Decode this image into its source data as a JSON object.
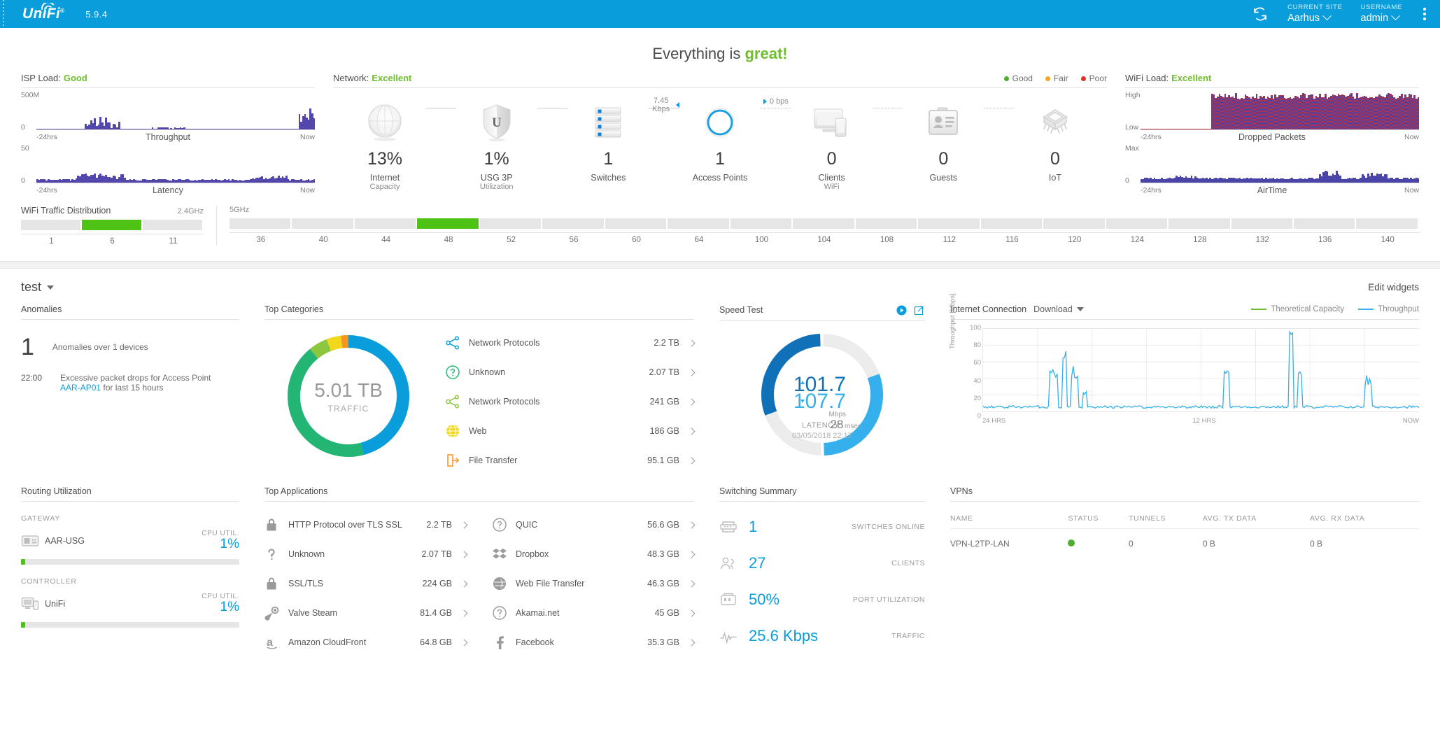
{
  "topbar": {
    "logo": "UniFi",
    "version": "5.9.4",
    "refresh_icon": "refresh-icon",
    "current_site_label": "CURRENT SITE",
    "current_site_value": "Aarhus",
    "username_label": "USERNAME",
    "username_value": "admin",
    "menu_icon": "kebab-menu-icon"
  },
  "hero": {
    "prefix": "Everything is ",
    "highlight": "great!"
  },
  "isp": {
    "title": "ISP Load:",
    "status": "Good",
    "throughput": {
      "ymax": "500M",
      "ymin": "0",
      "xleft": "-24hrs",
      "xright": "Now",
      "label": "Throughput"
    },
    "latency": {
      "ymax": "50",
      "ymin": "0",
      "xleft": "-24hrs",
      "xright": "Now",
      "label": "Latency"
    }
  },
  "network": {
    "title": "Network:",
    "status": "Excellent",
    "legend": [
      {
        "label": "Good",
        "color": "#4caf2f"
      },
      {
        "label": "Fair",
        "color": "#f5a623"
      },
      {
        "label": "Poor",
        "color": "#e0342b"
      }
    ],
    "link_labels": {
      "wan_to_usg": "",
      "usg_to_switch": "",
      "switch_to_ap": "7.45 Kbps",
      "ap_to_clients": "0 bps"
    },
    "nodes": [
      {
        "icon": "globe-icon",
        "value": "13%",
        "label1": "Internet",
        "label2": "Capacity"
      },
      {
        "icon": "shield-usg-icon",
        "value": "1%",
        "label1": "USG 3P",
        "label2": "Utilization"
      },
      {
        "icon": "switch-icon",
        "value": "1",
        "label1": "Switches",
        "label2": ""
      },
      {
        "icon": "ap-icon",
        "value": "1",
        "label1": "Access Points",
        "label2": ""
      },
      {
        "icon": "clients-icon",
        "value": "0",
        "label1": "Clients",
        "label2": "WiFi"
      },
      {
        "icon": "guest-icon",
        "value": "0",
        "label1": "Guests",
        "label2": ""
      },
      {
        "icon": "iot-chip-icon",
        "value": "0",
        "label1": "IoT",
        "label2": ""
      }
    ]
  },
  "wifiload": {
    "title": "WiFi Load:",
    "status": "Excellent",
    "dropped": {
      "ymax": "High",
      "ymin": "Low",
      "xleft": "-24hrs",
      "xright": "Now",
      "label": "Dropped Packets"
    },
    "airtime": {
      "ymax": "Max",
      "ymin": "0",
      "xleft": "-24hrs",
      "xright": "Now",
      "label": "AirTime"
    }
  },
  "wifi_distribution": {
    "title": "WiFi Traffic Distribution",
    "band_24": "2.4GHz",
    "band_5": "5GHz",
    "ticks_24": [
      "1",
      "6",
      "11"
    ],
    "ticks_5": [
      "36",
      "40",
      "44",
      "48",
      "52",
      "56",
      "60",
      "64",
      "100",
      "104",
      "108",
      "112",
      "116",
      "120",
      "124",
      "128",
      "132",
      "136",
      "140"
    ],
    "active_24": "6",
    "active_5": "48",
    "active_color": "#4fc313"
  },
  "dashboard": {
    "name": "test",
    "edit_widgets": "Edit widgets"
  },
  "anomalies": {
    "title": "Anomalies",
    "count": "1",
    "subtitle": "Anomalies over 1 devices",
    "event_time": "22:00",
    "event_text_1": "Excessive packet drops for Access Point",
    "event_link": "AAR-AP01",
    "event_text_2": "for last 15 hours"
  },
  "top_categories": {
    "title": "Top Categories",
    "donut_center_value": "5.01 TB",
    "donut_center_label": "TRAFFIC",
    "items": [
      {
        "icon": "share-nodes-icon",
        "icon_color": "#0a9ddc",
        "name": "Network Protocols",
        "value": "2.2 TB"
      },
      {
        "icon": "question-circle-icon",
        "icon_color": "#22b573",
        "name": "Unknown",
        "value": "2.07 TB"
      },
      {
        "icon": "share-nodes-icon",
        "icon_color": "#8cc63f",
        "name": "Network Protocols",
        "value": "241 GB"
      },
      {
        "icon": "globe-web-icon",
        "icon_color": "#f2d71a",
        "name": "Web",
        "value": "186 GB"
      },
      {
        "icon": "file-transfer-icon",
        "icon_color": "#f7941e",
        "name": "File Transfer",
        "value": "95.1 GB"
      }
    ]
  },
  "chart_data": {
    "type": "pie",
    "title": "Top Categories",
    "labels": [
      "Network Protocols",
      "Unknown",
      "Network Protocols",
      "Web",
      "File Transfer"
    ],
    "values": [
      2.2,
      2.07,
      0.241,
      0.186,
      0.0951
    ],
    "unit": "TB",
    "colors": [
      "#0a9ddc",
      "#22b573",
      "#8cc63f",
      "#f2d71a",
      "#f7941e"
    ],
    "total": "5.01 TB"
  },
  "speed_test": {
    "title": "Speed Test",
    "run_icon": "play-circle-icon",
    "popout_icon": "external-link-icon",
    "upload": "101.7",
    "download": "107.7",
    "unit": "Mbps",
    "latency_label": "LATENCY",
    "latency_value": "28",
    "latency_unit": "msec",
    "timestamp": "03/05/2018 22:17",
    "upload_color": "#1071b8",
    "download_color": "#35b0ec"
  },
  "internet_connection": {
    "title": "Internet Connection",
    "mode": "Download",
    "legend": [
      {
        "label": "Theoretical Capacity",
        "color": "#6fbe2e"
      },
      {
        "label": "Throughput",
        "color": "#35b0ec"
      }
    ],
    "ylabel": "Throughput [Mbps]",
    "yticks": [
      "100",
      "80",
      "60",
      "40",
      "20",
      "0"
    ],
    "xticks": [
      "24 HRS",
      "12 HRS",
      "NOW"
    ]
  },
  "routing_utilization": {
    "title": "Routing Utilization",
    "rows": [
      {
        "group": "GATEWAY",
        "icon": "gateway-icon",
        "name": "AAR-USG",
        "metric_label": "CPU UTIL.",
        "metric_value": "1%",
        "bar_pct": 2
      },
      {
        "group": "CONTROLLER",
        "icon": "controller-icon",
        "name": "UniFi",
        "metric_label": "CPU UTIL.",
        "metric_value": "1%",
        "bar_pct": 2
      }
    ]
  },
  "top_applications": {
    "title": "Top Applications",
    "left": [
      {
        "icon": "lock-icon",
        "name": "HTTP Protocol over TLS SSL",
        "value": "2.2 TB"
      },
      {
        "icon": "question-mark-icon",
        "name": "Unknown",
        "value": "2.07 TB"
      },
      {
        "icon": "lock-icon",
        "name": "SSL/TLS",
        "value": "224 GB"
      },
      {
        "icon": "steam-icon",
        "name": "Valve Steam",
        "value": "81.4 GB"
      },
      {
        "icon": "amazon-icon",
        "name": "Amazon CloudFront",
        "value": "64.8 GB"
      }
    ],
    "right": [
      {
        "icon": "question-circle-icon",
        "name": "QUIC",
        "value": "56.6 GB"
      },
      {
        "icon": "dropbox-icon",
        "name": "Dropbox",
        "value": "48.3 GB"
      },
      {
        "icon": "web-file-transfer-icon",
        "name": "Web File Transfer",
        "value": "46.3 GB"
      },
      {
        "icon": "question-circle-icon",
        "name": "Akamai.net",
        "value": "45 GB"
      },
      {
        "icon": "facebook-icon",
        "name": "Facebook",
        "value": "35.3 GB"
      }
    ]
  },
  "switching_summary": {
    "title": "Switching Summary",
    "rows": [
      {
        "icon": "switch-stack-icon",
        "value": "1",
        "label": "SWITCHES ONLINE"
      },
      {
        "icon": "clients-users-icon",
        "value": "27",
        "label": "CLIENTS"
      },
      {
        "icon": "port-icon",
        "value": "50%",
        "label": "PORT UTILIZATION"
      },
      {
        "icon": "traffic-wave-icon",
        "value": "25.6 Kbps",
        "label": "TRAFFIC"
      }
    ]
  },
  "vpns": {
    "title": "VPNs",
    "columns": [
      "NAME",
      "STATUS",
      "TUNNELS",
      "AVG. TX DATA",
      "AVG. RX DATA"
    ],
    "rows": [
      {
        "name": "VPN-L2TP-LAN",
        "status": "online",
        "tunnels": "0",
        "tx": "0 B",
        "rx": "0 B"
      }
    ]
  }
}
